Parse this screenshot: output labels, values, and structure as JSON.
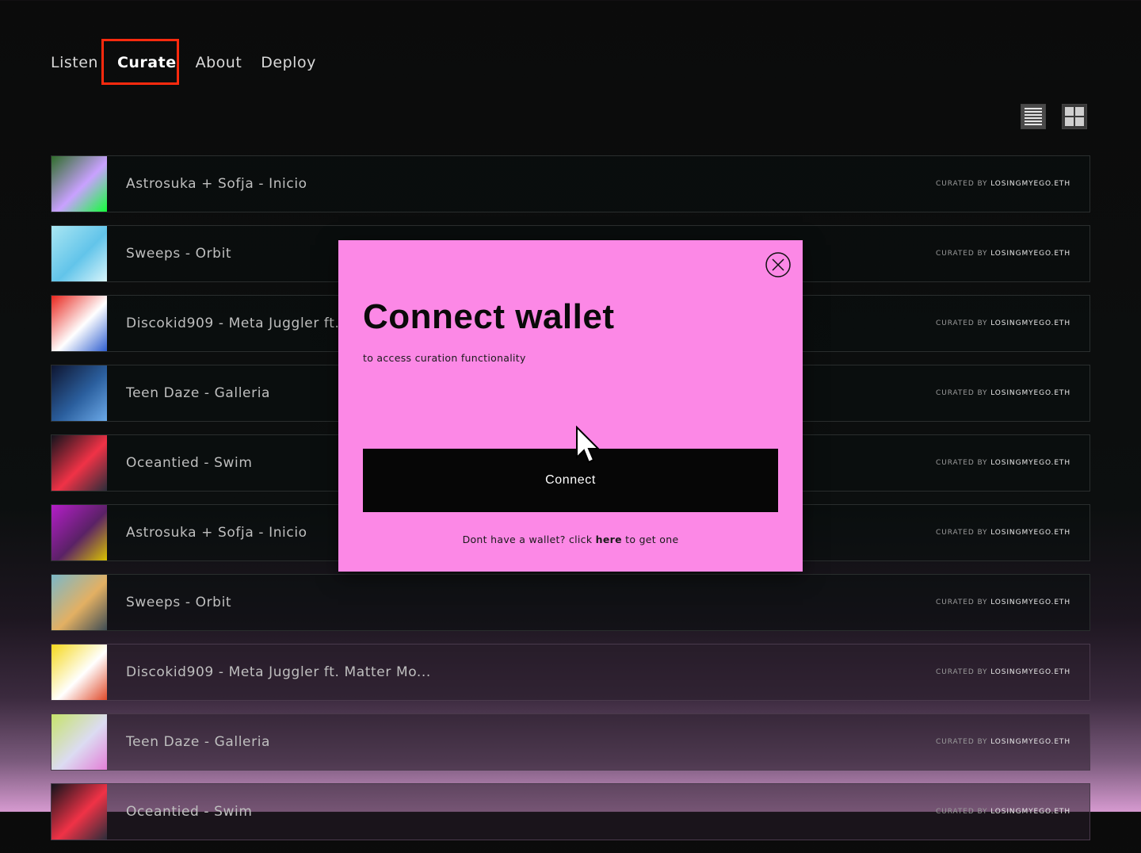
{
  "nav": {
    "items": [
      {
        "label": "Listen"
      },
      {
        "label": "Curate"
      },
      {
        "label": "About"
      },
      {
        "label": "Deploy"
      }
    ]
  },
  "view_toggle": {
    "list_icon": "list-view-icon",
    "grid_icon": "grid-view-icon"
  },
  "tracks": [
    {
      "title": "Astrosuka + Sofja - Inicio",
      "curated_prefix": "CURATED BY",
      "curator": "LOSINGMYEGO.ETH",
      "thumb_colors": [
        "#2f6d2a",
        "#c9a1ff",
        "#13ff3a"
      ]
    },
    {
      "title": "Sweeps - Orbit",
      "curated_prefix": "CURATED BY",
      "curator": "LOSINGMYEGO.ETH",
      "thumb_colors": [
        "#a9e6f2",
        "#62c4ea",
        "#d7f4fa"
      ]
    },
    {
      "title": "Discokid909 - Meta Juggler ft. Matter Mo...",
      "curated_prefix": "CURATED BY",
      "curator": "LOSINGMYEGO.ETH",
      "thumb_colors": [
        "#e8271e",
        "#ffffff",
        "#2f5fd0"
      ]
    },
    {
      "title": "Teen Daze - Galleria",
      "curated_prefix": "CURATED BY",
      "curator": "LOSINGMYEGO.ETH",
      "thumb_colors": [
        "#0e1530",
        "#2b5f9e",
        "#6ba9e8"
      ]
    },
    {
      "title": "Oceantied - Swim",
      "curated_prefix": "CURATED BY",
      "curator": "LOSINGMYEGO.ETH",
      "thumb_colors": [
        "#12141c",
        "#f03246",
        "#2a2d3a"
      ]
    },
    {
      "title": "Astrosuka + Sofja - Inicio",
      "curated_prefix": "CURATED BY",
      "curator": "LOSINGMYEGO.ETH",
      "thumb_colors": [
        "#b41ec8",
        "#5a2166",
        "#d9c200"
      ]
    },
    {
      "title": "Sweeps - Orbit",
      "curated_prefix": "CURATED BY",
      "curator": "LOSINGMYEGO.ETH",
      "thumb_colors": [
        "#7bb8c8",
        "#e3b063",
        "#3f4d55"
      ]
    },
    {
      "title": "Discokid909 - Meta Juggler ft. Matter Mo...",
      "curated_prefix": "CURATED BY",
      "curator": "LOSINGMYEGO.ETH",
      "thumb_colors": [
        "#f6d81c",
        "#ffffff",
        "#e04a2a"
      ]
    },
    {
      "title": "Teen Daze - Galleria",
      "curated_prefix": "CURATED BY",
      "curator": "LOSINGMYEGO.ETH",
      "thumb_colors": [
        "#c6e36a",
        "#dcdcf2",
        "#e37fd7"
      ]
    },
    {
      "title": "Oceantied - Swim",
      "curated_prefix": "CURATED BY",
      "curator": "LOSINGMYEGO.ETH",
      "thumb_colors": [
        "#12141c",
        "#f03246",
        "#2a2d3a"
      ]
    }
  ],
  "modal": {
    "title": "Connect wallet",
    "subtitle": "to access curation functionality",
    "connect_label": "Connect",
    "foot_before": "Dont have a wallet? click ",
    "foot_link": "here",
    "foot_after": " to get one",
    "background": "#fc88e6"
  },
  "colors": {
    "active_highlight": "#ff2a0e",
    "button_bg": "#060606"
  }
}
